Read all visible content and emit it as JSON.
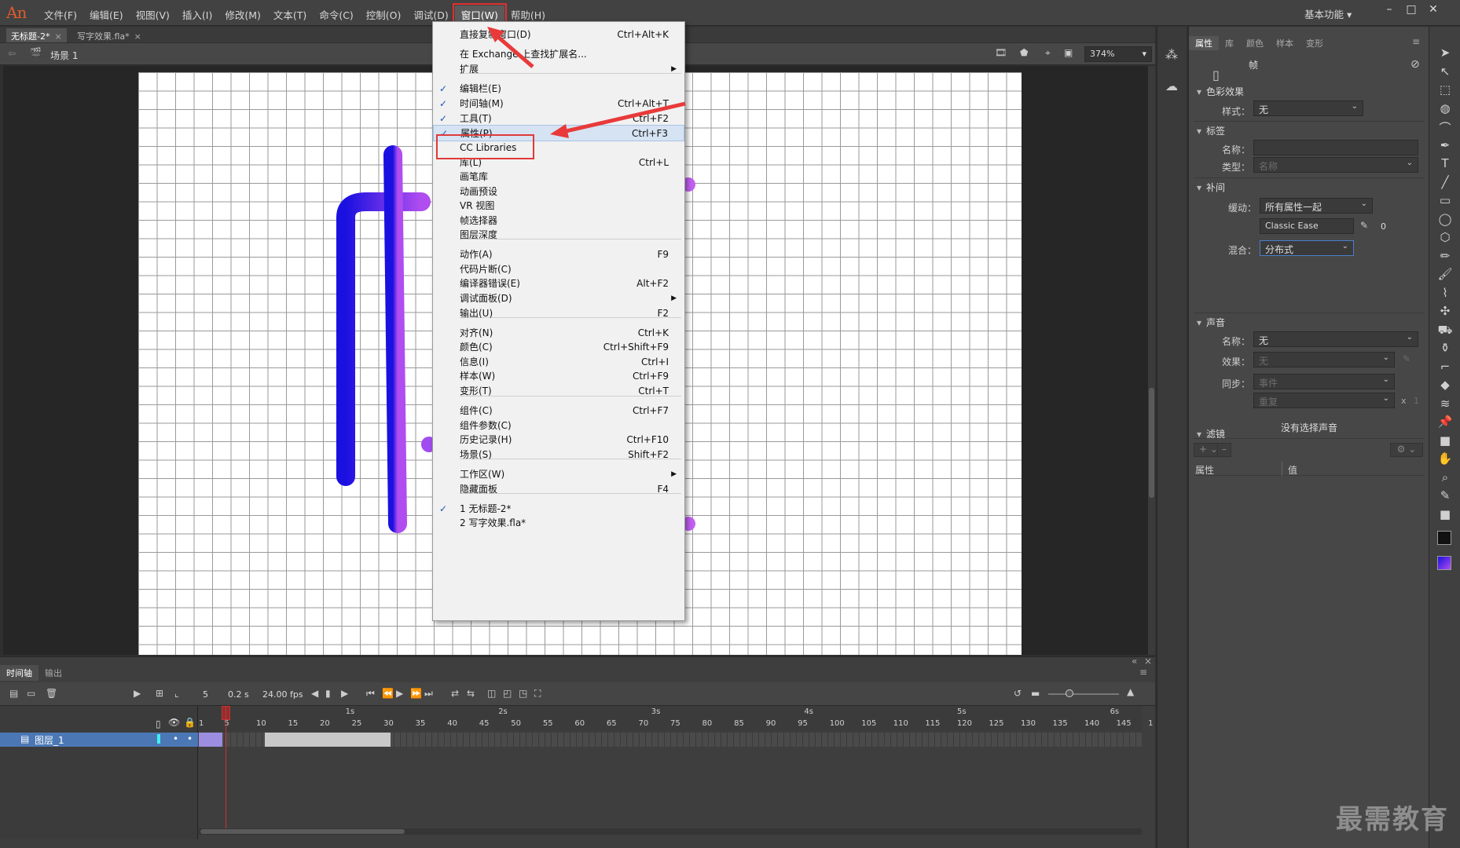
{
  "app": {
    "logo": "An",
    "workspace": "基本功能"
  },
  "menubar": {
    "items": [
      "文件(F)",
      "编辑(E)",
      "视图(V)",
      "插入(I)",
      "修改(M)",
      "文本(T)",
      "命令(C)",
      "控制(O)",
      "调试(D)",
      "窗口(W)",
      "帮助(H)"
    ],
    "active_index": 9
  },
  "doc_tabs": [
    {
      "label": "无标题-2*",
      "active": true
    },
    {
      "label": "写字效果.fla*",
      "active": false
    }
  ],
  "editbar": {
    "scene": "场景 1",
    "zoom": "374%"
  },
  "window_menu": {
    "items": [
      {
        "label": "直接复制窗口(D)",
        "shortcut": "Ctrl+Alt+K"
      },
      {
        "label": "在 Exchange 上查找扩展名...",
        "shortcut": ""
      },
      {
        "label": "扩展",
        "shortcut": "",
        "submenu": true
      },
      {
        "label": "编辑栏(E)",
        "shortcut": "",
        "checked": true
      },
      {
        "label": "时间轴(M)",
        "shortcut": "Ctrl+Alt+T",
        "checked": true
      },
      {
        "label": "工具(T)",
        "shortcut": "Ctrl+F2",
        "checked": true
      },
      {
        "label": "属性(P)",
        "shortcut": "Ctrl+F3",
        "checked": true,
        "highlighted": true
      },
      {
        "label": "CC Libraries",
        "shortcut": ""
      },
      {
        "label": "库(L)",
        "shortcut": "Ctrl+L"
      },
      {
        "label": "画笔库",
        "shortcut": ""
      },
      {
        "label": "动画预设",
        "shortcut": ""
      },
      {
        "label": "VR 视图",
        "shortcut": ""
      },
      {
        "label": "帧选择器",
        "shortcut": ""
      },
      {
        "label": "图层深度",
        "shortcut": ""
      },
      {
        "label": "动作(A)",
        "shortcut": "F9"
      },
      {
        "label": "代码片断(C)",
        "shortcut": ""
      },
      {
        "label": "编译器错误(E)",
        "shortcut": "Alt+F2"
      },
      {
        "label": "调试面板(D)",
        "shortcut": "",
        "submenu": true
      },
      {
        "label": "输出(U)",
        "shortcut": "F2"
      },
      {
        "label": "对齐(N)",
        "shortcut": "Ctrl+K"
      },
      {
        "label": "颜色(C)",
        "shortcut": "Ctrl+Shift+F9"
      },
      {
        "label": "信息(I)",
        "shortcut": "Ctrl+I"
      },
      {
        "label": "样本(W)",
        "shortcut": "Ctrl+F9"
      },
      {
        "label": "变形(T)",
        "shortcut": "Ctrl+T"
      },
      {
        "label": "组件(C)",
        "shortcut": "Ctrl+F7"
      },
      {
        "label": "组件参数(C)",
        "shortcut": ""
      },
      {
        "label": "历史记录(H)",
        "shortcut": "Ctrl+F10"
      },
      {
        "label": "场景(S)",
        "shortcut": "Shift+F2"
      },
      {
        "label": "工作区(W)",
        "shortcut": "",
        "submenu": true
      },
      {
        "label": "隐藏面板",
        "shortcut": "F4"
      },
      {
        "label": "1 无标题-2*",
        "shortcut": "",
        "checked": true
      },
      {
        "label": "2 写字效果.fla*",
        "shortcut": ""
      }
    ]
  },
  "properties": {
    "tabs": [
      "属性",
      "库",
      "颜色",
      "样本",
      "变形"
    ],
    "object_type": "帧",
    "color_effect": {
      "title": "色彩效果",
      "style_label": "样式：",
      "style_value": "无"
    },
    "label": {
      "title": "标签",
      "name_label": "名称：",
      "type_label": "类型：",
      "type_value": "名称"
    },
    "tween": {
      "title": "补间",
      "ease_label": "缓动：",
      "ease_value": "所有属性一起",
      "ease_preset": "Classic Ease",
      "ease_amount": "0",
      "blend_label": "混合：",
      "blend_value": "分布式"
    },
    "sound": {
      "title": "声音",
      "name_label": "名称：",
      "name_value": "无",
      "effect_label": "效果：",
      "effect_value": "无",
      "sync_label": "同步：",
      "sync_value": "事件",
      "repeat_value": "重复",
      "repeat_x": "x",
      "repeat_count": "1",
      "no_sound": "没有选择声音"
    },
    "filters": {
      "title": "滤镜",
      "col_prop": "属性",
      "col_value": "值"
    }
  },
  "timeline": {
    "tabs": [
      "时间轴",
      "输出"
    ],
    "current_frame": "5",
    "time": "0.2 s",
    "fps": "24.00 fps",
    "layer_name": "图层_1",
    "ruler_numbers": [
      "1",
      "5",
      "10",
      "15",
      "20",
      "25",
      "30",
      "35",
      "40",
      "45",
      "50",
      "55",
      "60",
      "65",
      "70",
      "75",
      "80",
      "85",
      "90",
      "95",
      "100",
      "105",
      "110",
      "115",
      "120",
      "125",
      "130",
      "135",
      "140",
      "145",
      "1"
    ],
    "seconds": [
      "1s",
      "2s",
      "3s",
      "4s",
      "5s",
      "6s"
    ]
  },
  "watermark": "最需教育",
  "colors": {
    "stroke_start": "#1a10e0",
    "stroke_end": "#b04df0",
    "accent_red": "#e03a3a",
    "highlight": "#d6e3f3"
  }
}
